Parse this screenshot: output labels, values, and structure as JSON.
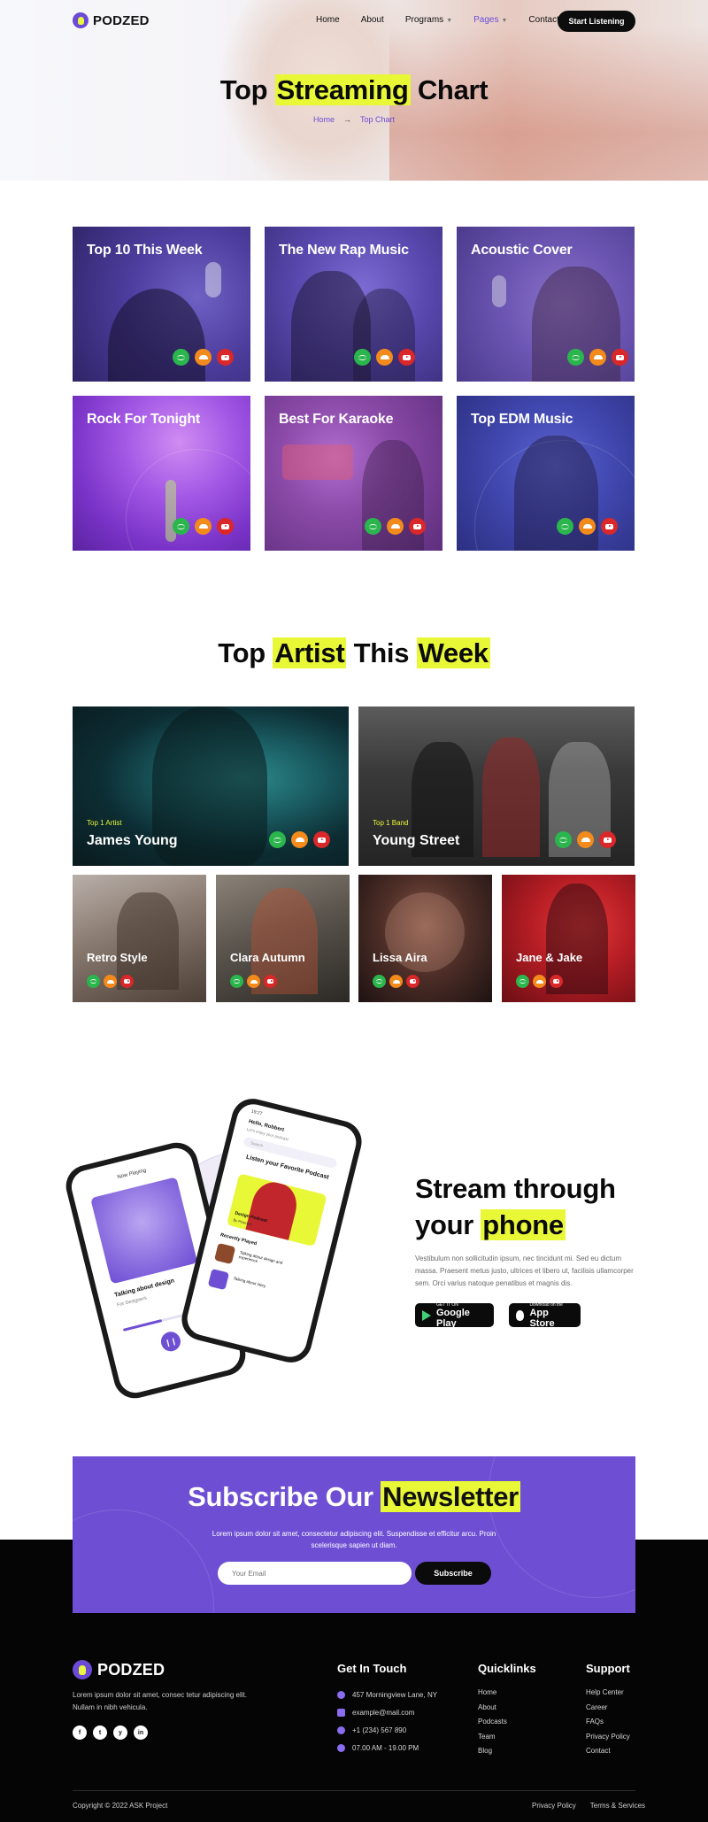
{
  "brand": {
    "name": "PODZED",
    "accent": "#6e4fd4",
    "highlight": "#e8f736"
  },
  "nav": {
    "items": [
      {
        "label": "Home"
      },
      {
        "label": "About"
      },
      {
        "label": "Programs"
      },
      {
        "label": "Pages"
      },
      {
        "label": "Contact"
      }
    ],
    "active": "Pages",
    "cta": "Start Listening"
  },
  "hero": {
    "title_pre": "Top ",
    "title_hl": "Streaming",
    "title_post": " Chart",
    "breadcrumb": {
      "home": "Home",
      "current": "Top Chart"
    }
  },
  "playlists": [
    {
      "title": "Top 10 This Week"
    },
    {
      "title": "The New Rap Music"
    },
    {
      "title": "Acoustic Cover"
    },
    {
      "title": "Rock For Tonight"
    },
    {
      "title": "Best For Karaoke"
    },
    {
      "title": "Top EDM Music"
    }
  ],
  "top_artists": {
    "title_pre": "Top ",
    "title_hl1": "Artist",
    "title_mid": " This ",
    "title_hl2": "Week",
    "featured": [
      {
        "sub": "Top 1 Artist",
        "name": "James Young"
      },
      {
        "sub": "Top 1 Band",
        "name": "Young Street"
      }
    ],
    "others": [
      {
        "name": "Retro Style"
      },
      {
        "name": "Clara Autumn"
      },
      {
        "name": "Lissa Aira"
      },
      {
        "name": "Jane & Jake"
      }
    ]
  },
  "stream": {
    "title_line1": "Stream through",
    "title_pre": "your ",
    "title_hl": "phone",
    "desc": "Vestibulum non sollicitudin ipsum, nec tincidunt mi. Sed eu dictum massa. Praesent metus justo, ultrices et libero ut, facilisis ullamcorper sem. Orci varius natoque penatibus et magnis dis.",
    "google": {
      "small": "GET IT ON",
      "big": "Google Play"
    },
    "apple": {
      "small": "Download on the",
      "big": "App Store"
    },
    "phone_left": {
      "header": "Now Playing",
      "song": "Talking about design",
      "artist": "For Designers"
    },
    "phone_right": {
      "time": "19:27",
      "greeting": "Hello, Robbert",
      "sub": "Let's enjoy your podcast",
      "search": "Search",
      "headline": "Listen your Favorite Podcast",
      "card_title": "Design Podcast",
      "card_sub": "By Peterson",
      "recent": "Recently Played",
      "item1": "Talking about design and experience",
      "item2": "Talking about story"
    }
  },
  "newsletter": {
    "title_pre": "Subscribe Our ",
    "title_hl": "Newsletter",
    "desc": "Lorem ipsum dolor sit amet, consectetur adipiscing elit. Suspendisse et efficitur arcu. Proin scelerisque sapien ut diam.",
    "placeholder": "Your Email",
    "button": "Subscribe"
  },
  "footer": {
    "desc": "Lorem ipsum dolor sit amet, consec tetur adipiscing elit. Nullam in nibh vehicula.",
    "social": [
      "f",
      "t",
      "y",
      "in"
    ],
    "contact_title": "Get In Touch",
    "contact": [
      "457 Morningview Lane, NY",
      "example@mail.com",
      "+1 (234) 567 890",
      "07.00 AM - 19.00 PM"
    ],
    "quick_title": "Quicklinks",
    "quick": [
      "Home",
      "About",
      "Podcasts",
      "Team",
      "Blog"
    ],
    "support_title": "Support",
    "support": [
      "Help Center",
      "Career",
      "FAQs",
      "Privacy Policy",
      "Contact"
    ],
    "copyright": "Copyright © 2022 ASK Project",
    "legal": [
      "Privacy Policy",
      "Terms & Services"
    ]
  }
}
